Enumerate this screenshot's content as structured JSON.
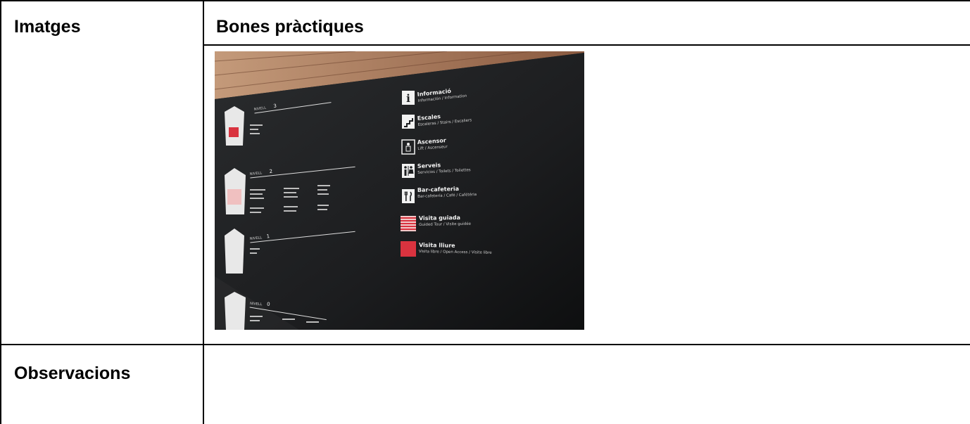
{
  "table": {
    "images_header": "Imatges",
    "practices_header": "Bones pràctiques",
    "observations_header": "Observacions"
  },
  "photo": {
    "legend": [
      {
        "title": "Informació",
        "subtitle": "Información / Information",
        "icon": "info-icon"
      },
      {
        "title": "Escales",
        "subtitle": "Escaleras / Stairs / Escaliers",
        "icon": "stairs-icon"
      },
      {
        "title": "Ascensor",
        "subtitle": "Lift / Ascenseur",
        "icon": "elevator-icon"
      },
      {
        "title": "Serveis",
        "subtitle": "Servicios / Toilets / Toilettes",
        "icon": "toilets-icon"
      },
      {
        "title": "Bar-cafeteria",
        "subtitle": "Bar-cafetería / Café / Cafétéria",
        "icon": "cafe-icon"
      },
      {
        "title": "Visita guiada",
        "subtitle": "Guided Tour / Visite guidée",
        "icon": "guided-tour-swatch"
      },
      {
        "title": "Visita lliure",
        "subtitle": "Visita libre / Open Access / Visite libre",
        "icon": "free-visit-swatch"
      }
    ],
    "levels": [
      {
        "label": "NIVELL",
        "number": "3"
      },
      {
        "label": "NIVELL",
        "number": "2"
      },
      {
        "label": "NIVELL",
        "number": "1"
      },
      {
        "label": "NIVELL",
        "number": "0"
      }
    ],
    "colors": {
      "wall": "#1d1f21",
      "brick": "#b07a5a",
      "accent_red": "#d9333f"
    }
  }
}
